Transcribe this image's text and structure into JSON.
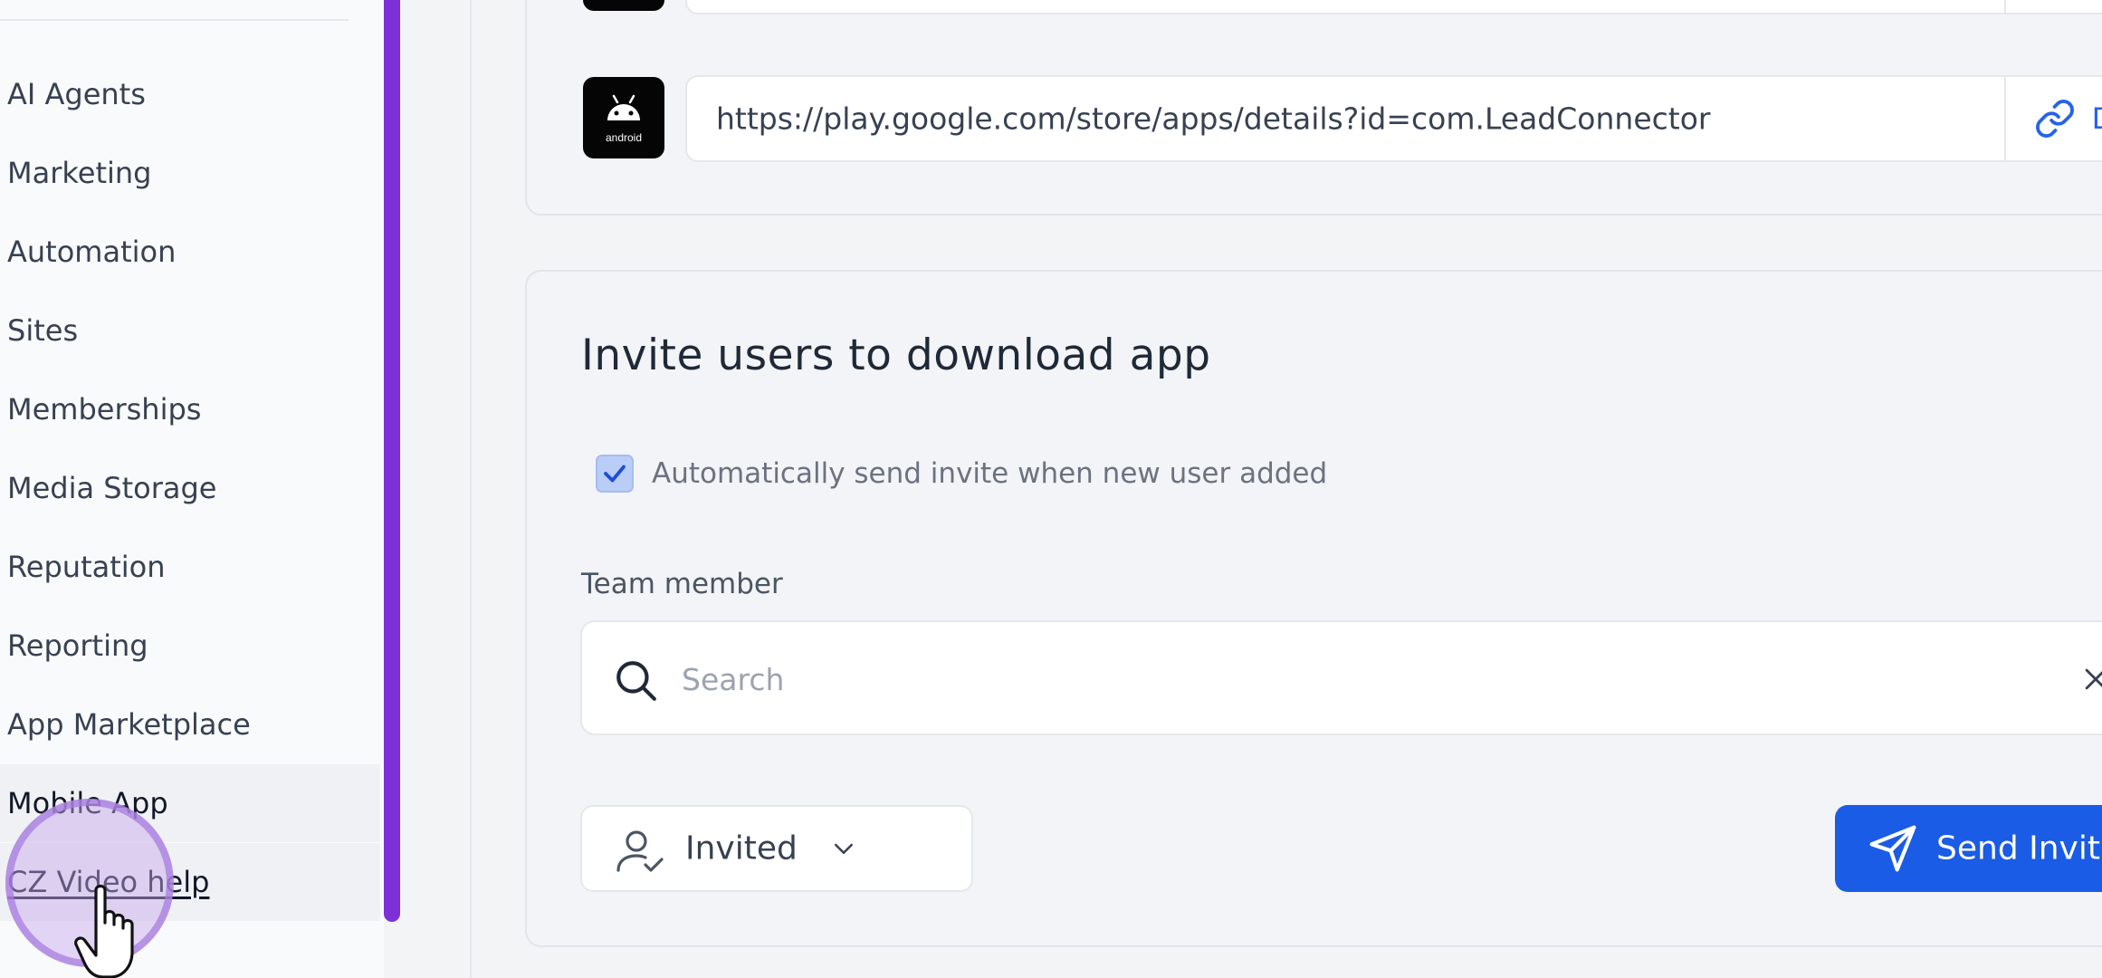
{
  "sidebar": {
    "items": [
      {
        "label": "AI Agents"
      },
      {
        "label": "Marketing"
      },
      {
        "label": "Automation"
      },
      {
        "label": "Sites"
      },
      {
        "label": "Memberships"
      },
      {
        "label": "Media Storage"
      },
      {
        "label": "Reputation"
      },
      {
        "label": "Reporting"
      },
      {
        "label": "App Marketplace"
      },
      {
        "label": "Mobile App"
      },
      {
        "label": "CZ Video help"
      }
    ],
    "active_item": "Mobile App"
  },
  "app_links": {
    "android": {
      "logo_text": "android",
      "url": "https://play.google.com/store/apps/details?id=com.LeadConnector",
      "download_label": "Downlo"
    }
  },
  "invite": {
    "title": "Invite users to download app",
    "auto_invite_label": "Automatically send invite when new user added",
    "auto_invite_checked": true,
    "team_member_label": "Team member",
    "search_placeholder": "Search",
    "search_value": "",
    "status_filter": "Invited",
    "send_button_label": "Send Invit"
  },
  "colors": {
    "accent": "#1a5ce5",
    "scrollbar": "#7f2fd6",
    "link": "#2563eb"
  }
}
